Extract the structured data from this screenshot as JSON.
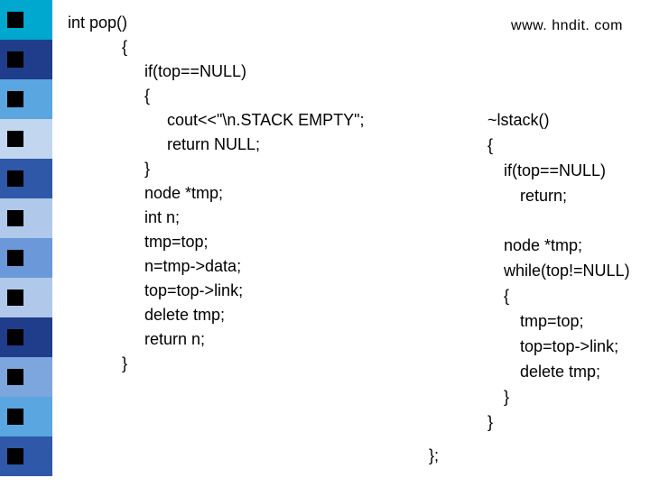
{
  "url": "www. hndit. com",
  "left": {
    "l0": "int pop()",
    "l1": "{",
    "l2": "if(top==NULL)",
    "l3": "{",
    "l4": "cout<<\"\\n.STACK EMPTY\";",
    "l5": "return NULL;",
    "l6": "}",
    "l7": "node *tmp;",
    "l8": "int n;",
    "l9": "tmp=top;",
    "l10": "n=tmp->data;",
    "l11": "top=top->link;",
    "l12": "delete tmp;",
    "l13": "return n;",
    "l14": "}"
  },
  "right": {
    "r0": "~lstack()",
    "r1": "{",
    "r2": "if(top==NULL)",
    "r3": "return;",
    "r4": "node *tmp;",
    "r5": "while(top!=NULL)",
    "r6": "{",
    "r7": "tmp=top;",
    "r8": "top=top->link;",
    "r9": "delete tmp;",
    "r10": "}",
    "r11": "}"
  },
  "closing": "};",
  "sidebar_colors": [
    "#00a7cf",
    "#1f3d8a",
    "#5aa6e0",
    "#c2d7ef",
    "#2f58a8",
    "#b0c9ea",
    "#6a98d8",
    "#b0c9ea",
    "#1f3d8a",
    "#7ca6dd",
    "#5aa6e0",
    "#2f58a8"
  ]
}
